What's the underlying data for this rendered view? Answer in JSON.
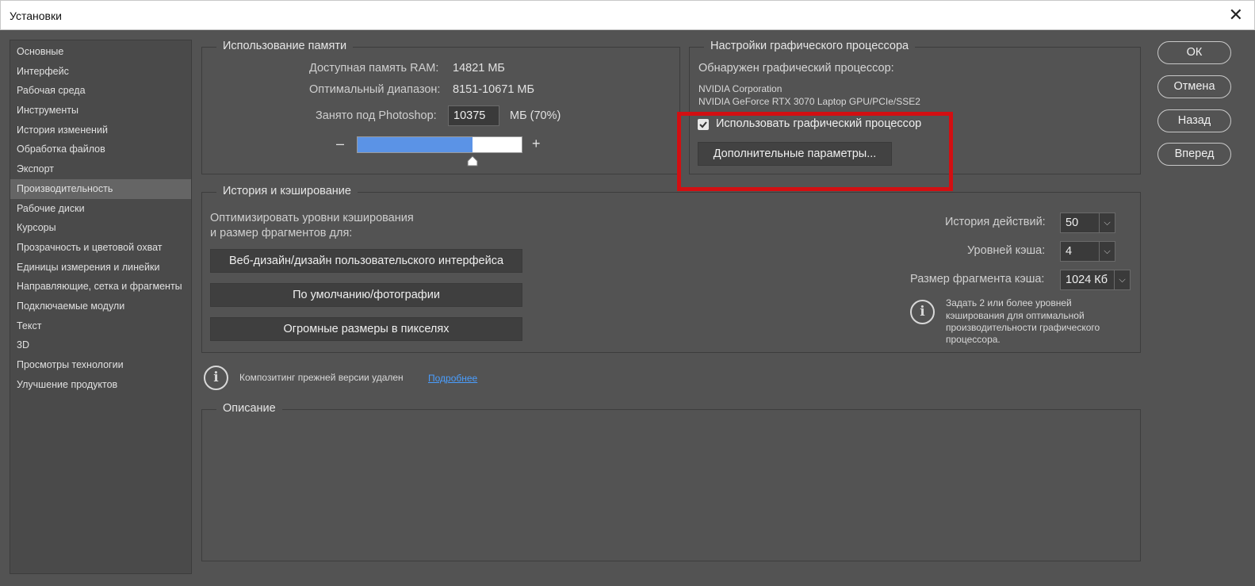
{
  "window": {
    "title": "Установки",
    "close_icon": "✕"
  },
  "sidebar": {
    "items": [
      "Основные",
      "Интерфейс",
      "Рабочая среда",
      "Инструменты",
      "История изменений",
      "Обработка файлов",
      "Экспорт",
      "Производительность",
      "Рабочие диски",
      "Курсоры",
      "Прозрачность и цветовой охват",
      "Единицы измерения и линейки",
      "Направляющие, сетка и фрагменты",
      "Подключаемые модули",
      "Текст",
      "3D",
      "Просмотры технологии",
      "Улучшение продуктов"
    ],
    "active_index": 7
  },
  "memory": {
    "legend": "Использование памяти",
    "available_label": "Доступная память RAM:",
    "available_value": "14821 МБ",
    "optimal_label": "Оптимальный диапазон:",
    "optimal_value": "8151-10671 МБ",
    "used_label": "Занято под Photoshop:",
    "used_value": "10375",
    "used_unit": "МБ (70%)",
    "minus": "–",
    "plus": "+",
    "slider_fraction": 0.7
  },
  "gpu": {
    "legend": "Настройки графического процессора",
    "detected_label": "Обнаружен графический процессор:",
    "vendor": "NVIDIA Corporation",
    "model": "NVIDIA GeForce RTX 3070 Laptop GPU/PCIe/SSE2",
    "use_gpu_label": "Использовать графический процессор",
    "use_gpu_checked": true,
    "advanced_button": "Дополнительные параметры..."
  },
  "cache": {
    "legend": "История и кэширование",
    "optimize_line1": "Оптимизировать уровни кэширования",
    "optimize_line2": "и размер фрагментов для:",
    "preset_web": "Веб-дизайн/дизайн пользовательского интерфейса",
    "preset_default": "По умолчанию/фотографии",
    "preset_huge": "Огромные размеры в пикселях",
    "history_label": "История действий:",
    "history_value": "50",
    "levels_label": "Уровней кэша:",
    "levels_value": "4",
    "tile_label": "Размер фрагмента кэша:",
    "tile_value": "1024 Кб",
    "hint_line1": "Задать 2 или более уровней",
    "hint_line2": "кэширования для оптимальной",
    "hint_line3": "производительности графического",
    "hint_line4": "процессора."
  },
  "legacy": {
    "text": "Композитинг прежней версии удален",
    "link": "Подробнее"
  },
  "description": {
    "legend": "Описание"
  },
  "actions": {
    "ok": "ОК",
    "cancel": "Отмена",
    "back": "Назад",
    "forward": "Вперед"
  },
  "colors": {
    "background": "#535353",
    "slider_fill": "#5b93e6",
    "highlight": "#d20f12",
    "link": "#4a9eff"
  }
}
